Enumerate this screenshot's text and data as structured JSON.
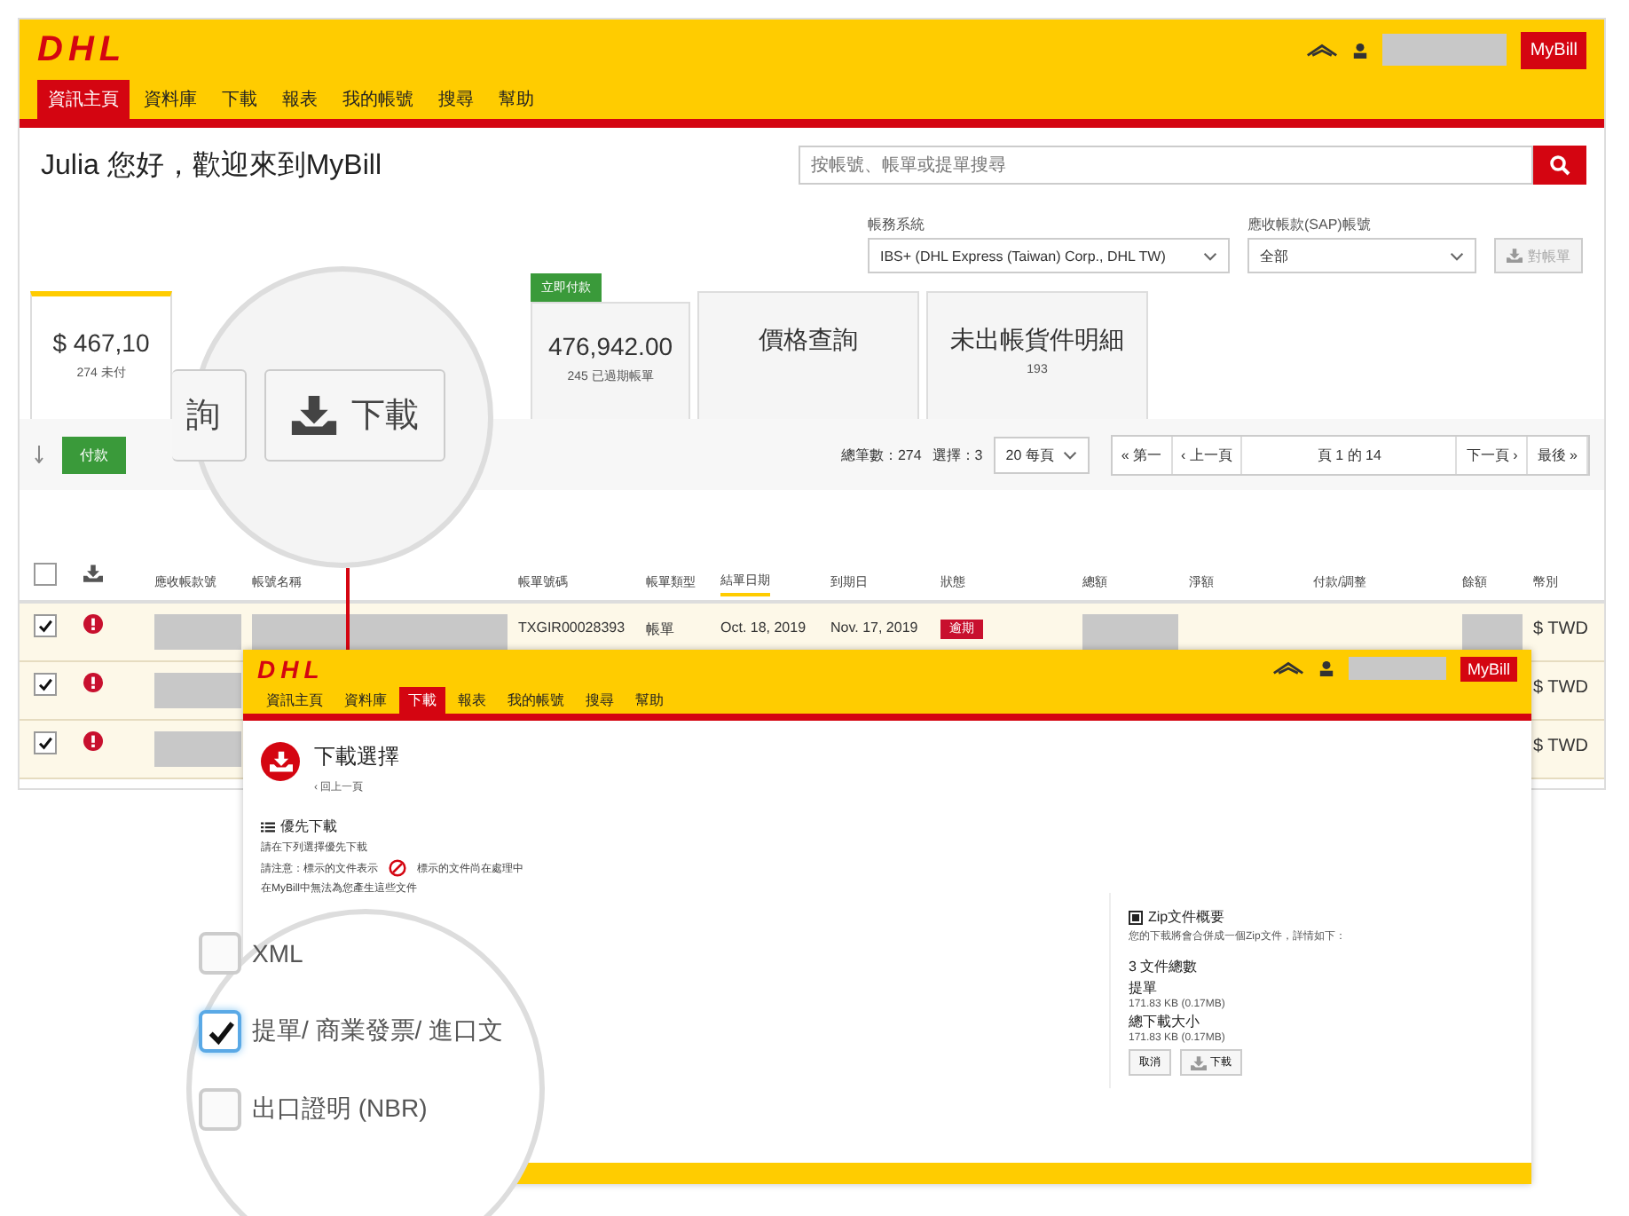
{
  "header": {
    "logo": "DHL",
    "app_button": "MyBill"
  },
  "nav": [
    {
      "label": "資訊主頁",
      "selected": true
    },
    {
      "label": "資料庫",
      "selected": false
    },
    {
      "label": "下載",
      "selected": false
    },
    {
      "label": "報表",
      "selected": false
    },
    {
      "label": "我的帳號",
      "selected": false
    },
    {
      "label": "搜尋",
      "selected": false
    },
    {
      "label": "幫助",
      "selected": false
    }
  ],
  "greeting": "Julia 您好，歡迎來到MyBill",
  "search": {
    "placeholder": "按帳號、帳單或提單搜尋"
  },
  "filters": [
    {
      "label": "帳務系統",
      "value": "IBS+ (DHL Express (Taiwan) Corp., DHL TW)"
    },
    {
      "label": "應收帳款(SAP)帳號",
      "value": "全部"
    }
  ],
  "statement_button": "對帳單",
  "tiles": [
    {
      "amount": "$ 467,10",
      "caption": "274 未付",
      "selected": true
    },
    {
      "amount": "476,942.00",
      "caption": "245 已過期帳單",
      "badge": "立即付款",
      "selected": false
    },
    {
      "amount": "價格查詢",
      "selected": false
    },
    {
      "amount": "未出帳貨件明細",
      "caption": "193",
      "selected": false
    }
  ],
  "pay_button": "付款",
  "pagination": {
    "total": "總筆數：274",
    "selected_count": "選擇：3",
    "page_size": "20 每頁",
    "first": "« 第一",
    "prev": "‹ 上一頁",
    "page": "頁 1 的 14",
    "next": "下一頁 ›",
    "last": "最後 »"
  },
  "table": {
    "all_checked": false,
    "columns": [
      {
        "label": "應收帳款號",
        "sorted": false
      },
      {
        "label": "帳號名稱",
        "sorted": false
      },
      {
        "label": "帳單號碼",
        "sorted": false
      },
      {
        "label": "帳單類型",
        "sorted": false
      },
      {
        "label": "結單日期",
        "sorted": true
      },
      {
        "label": "到期日",
        "sorted": false
      },
      {
        "label": "狀態",
        "sorted": false
      },
      {
        "label": "總額",
        "sorted": false
      },
      {
        "label": "淨額",
        "sorted": false
      },
      {
        "label": "付款/調整",
        "sorted": false
      },
      {
        "label": "餘額",
        "sorted": false
      },
      {
        "label": "幣別",
        "sorted": false
      }
    ],
    "rows": [
      {
        "checked": true,
        "invoice": "TXGIR00028393",
        "type": "帳單",
        "statement_date": "Oct. 18, 2019",
        "due_date": "Nov. 17, 2019",
        "status": "逾期",
        "currency": "$ TWD"
      },
      {
        "checked": true,
        "currency": "$ TWD"
      },
      {
        "checked": true,
        "currency": "$ TWD"
      }
    ]
  },
  "zoom_buttons": [
    {
      "label": "詢"
    },
    {
      "label": "下載"
    }
  ],
  "download_window": {
    "logo": "DHL",
    "app_button": "MyBill",
    "nav": [
      {
        "label": "資訊主頁",
        "selected": false
      },
      {
        "label": "資料庫",
        "selected": false
      },
      {
        "label": "下載",
        "selected": true
      },
      {
        "label": "報表",
        "selected": false
      },
      {
        "label": "我的帳號",
        "selected": false
      },
      {
        "label": "搜尋",
        "selected": false
      },
      {
        "label": "幫助",
        "selected": false
      }
    ],
    "title": "下載選擇",
    "back": "‹ 回上一頁",
    "priority_heading": "優先下載",
    "priority_lines": [
      "請在下列選擇優先下載",
      "請注意：標示的文件表示",
      "在MyBill中無法為您產生這些文件"
    ],
    "processing_note": "標示的文件尚在處理中",
    "zip_heading": "Zip文件概要",
    "zip_note": "您的下載將會合併成一個Zip文件，詳情如下：",
    "zip_count": "3 文件總數",
    "zip_item": "提單",
    "zip_item_size": "171.83 KB (0.17MB)",
    "zip_total_label": "總下載大小",
    "zip_total_size": "171.83 KB (0.17MB)",
    "cancel": "取消",
    "download": "下載"
  },
  "zoom_options": [
    {
      "label": "XML",
      "checked": false
    },
    {
      "label": "提單/ 商業發票/ 進口文",
      "checked": true
    },
    {
      "label": "出口證明 (NBR)",
      "checked": false
    }
  ]
}
